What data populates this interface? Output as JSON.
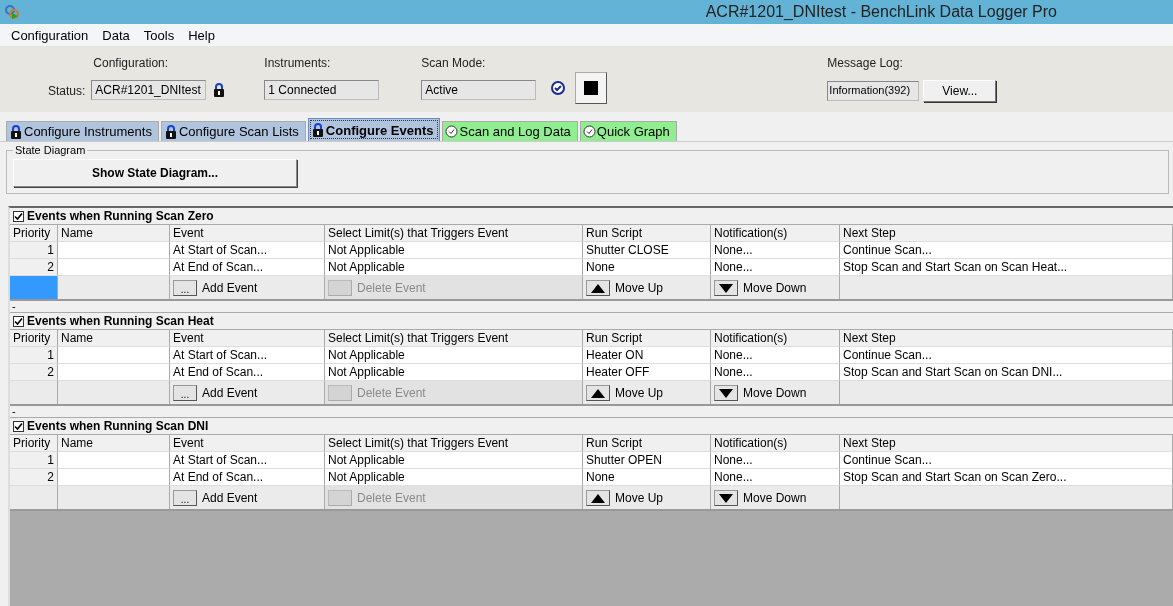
{
  "window": {
    "title": "ACR#1201_DNItest - BenchLink Data Logger Pro"
  },
  "menu": [
    "Configuration",
    "Data",
    "Tools",
    "Help"
  ],
  "status_panel": {
    "configuration_label": "Configuration:",
    "status_label": "Status:",
    "configuration_value": "ACR#1201_DNItest",
    "instruments_label": "Instruments:",
    "instruments_value": "1 Connected",
    "scan_mode_label": "Scan Mode:",
    "scan_mode_value": "Active",
    "message_log_label": "Message Log:",
    "message_log_value": "Information(392)",
    "view_button": "View..."
  },
  "tabs": [
    {
      "label": "Configure Instruments",
      "kind": "lock",
      "color": "#b0c4de",
      "selected": false
    },
    {
      "label": "Configure Scan Lists",
      "kind": "lock",
      "color": "#b0c4de",
      "selected": false
    },
    {
      "label": "Configure Events",
      "kind": "lock",
      "color": "#b0c4de",
      "selected": true
    },
    {
      "label": "Scan and Log Data",
      "kind": "clock",
      "color": "#90ee90",
      "selected": false
    },
    {
      "label": "Quick Graph",
      "kind": "clock",
      "color": "#90ee90",
      "selected": false
    }
  ],
  "state_diagram": {
    "group_label": "State Diagram",
    "button": "Show State Diagram..."
  },
  "sections": [
    {
      "title": "Events when Running Scan Zero",
      "checked": true,
      "action_row_selected": true,
      "footer": "-",
      "columns": [
        "Priority",
        "Name",
        "Event",
        "Select Limit(s) that Triggers Event",
        "Run Script",
        "Notification(s)",
        "Next Step"
      ],
      "rows": [
        {
          "priority": "1",
          "event": "At Start of Scan...",
          "limit": "Not Applicable",
          "script": "Shutter CLOSE",
          "notification": "None...",
          "next_step": "Continue Scan..."
        },
        {
          "priority": "2",
          "event": "At End of Scan...",
          "limit": "Not Applicable",
          "script": "None",
          "notification": "None...",
          "next_step": "Stop Scan and Start Scan on Scan Heat..."
        }
      ],
      "actions": {
        "add_glyph": "...",
        "add_label": "Add Event",
        "delete_label": "Delete Event",
        "delete_disabled": true,
        "move_up_label": "Move Up",
        "move_down_label": "Move Down"
      }
    },
    {
      "title": "Events when Running Scan Heat",
      "checked": true,
      "action_row_selected": false,
      "footer": "-",
      "columns": [
        "Priority",
        "Name",
        "Event",
        "Select Limit(s) that Triggers Event",
        "Run Script",
        "Notification(s)",
        "Next Step"
      ],
      "rows": [
        {
          "priority": "1",
          "event": "At Start of Scan...",
          "limit": "Not Applicable",
          "script": "Heater ON",
          "notification": "None...",
          "next_step": "Continue Scan..."
        },
        {
          "priority": "2",
          "event": "At End of Scan...",
          "limit": "Not Applicable",
          "script": "Heater OFF",
          "notification": "None...",
          "next_step": "Stop Scan and Start Scan on Scan DNI..."
        }
      ],
      "actions": {
        "add_glyph": "...",
        "add_label": "Add Event",
        "delete_label": "Delete Event",
        "delete_disabled": true,
        "move_up_label": "Move Up",
        "move_down_label": "Move Down"
      }
    },
    {
      "title": "Events when Running Scan DNI",
      "checked": true,
      "action_row_selected": false,
      "columns": [
        "Priority",
        "Name",
        "Event",
        "Select Limit(s) that Triggers Event",
        "Run Script",
        "Notification(s)",
        "Next Step"
      ],
      "rows": [
        {
          "priority": "1",
          "event": "At Start of Scan...",
          "limit": "Not Applicable",
          "script": "Shutter OPEN",
          "notification": "None...",
          "next_step": "Continue Scan..."
        },
        {
          "priority": "2",
          "event": "At End of Scan...",
          "limit": "Not Applicable",
          "script": "None",
          "notification": "None...",
          "next_step": "Stop Scan and Start Scan on Scan Zero..."
        }
      ],
      "actions": {
        "add_glyph": "...",
        "add_label": "Add Event",
        "delete_label": "Delete Event",
        "delete_disabled": true,
        "move_up_label": "Move Up",
        "move_down_label": "Move Down"
      }
    }
  ]
}
